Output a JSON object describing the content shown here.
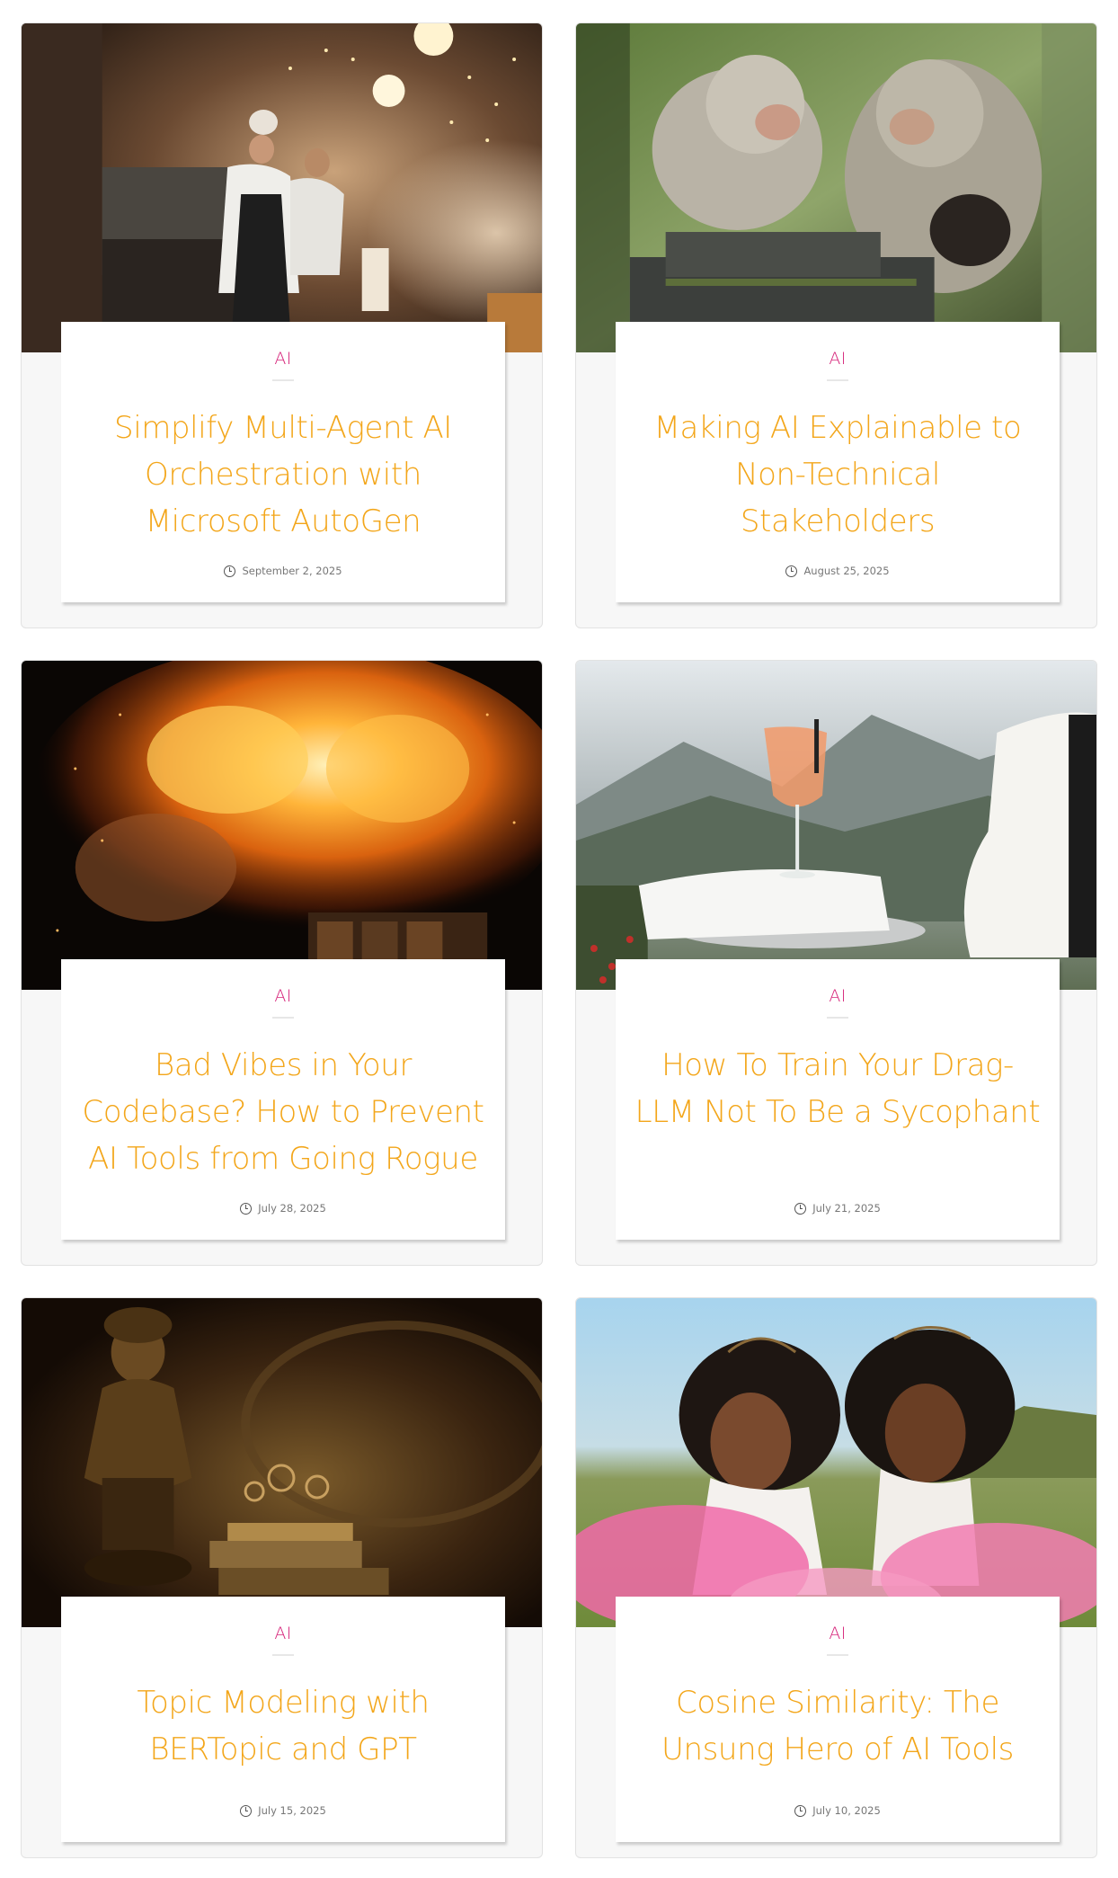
{
  "posts": [
    {
      "category": "AI",
      "title": "Simplify Multi-Agent AI Orchestration with Microsoft AutoGen",
      "date": "September 2, 2025",
      "image": "kitchen-chefs-photo"
    },
    {
      "category": "AI",
      "title": "Making AI Explainable to Non-Technical Stakeholders",
      "date": "August 25, 2025",
      "image": "monkeys-photo"
    },
    {
      "category": "AI",
      "title": "Bad Vibes in Your Codebase? How to Prevent AI Tools from Going Rogue",
      "date": "July 28, 2025",
      "image": "fire-photo"
    },
    {
      "category": "AI",
      "title": "How To Train Your Drag-LLM Not To Be a Sycophant",
      "date": "July 21, 2025",
      "image": "cocktail-tray-photo"
    },
    {
      "category": "AI",
      "title": "Topic Modeling with BERTopic and GPT",
      "date": "July 15, 2025",
      "image": "statue-bust-photo"
    },
    {
      "category": "AI",
      "title": "Cosine Similarity: The Unsung Hero of AI Tools",
      "date": "July 10, 2025",
      "image": "girls-crowns-photo"
    }
  ],
  "colors": {
    "category": "#d6247a",
    "title": "#f3a61a",
    "meta": "#777777",
    "card_bg": "#f7f7f7"
  }
}
